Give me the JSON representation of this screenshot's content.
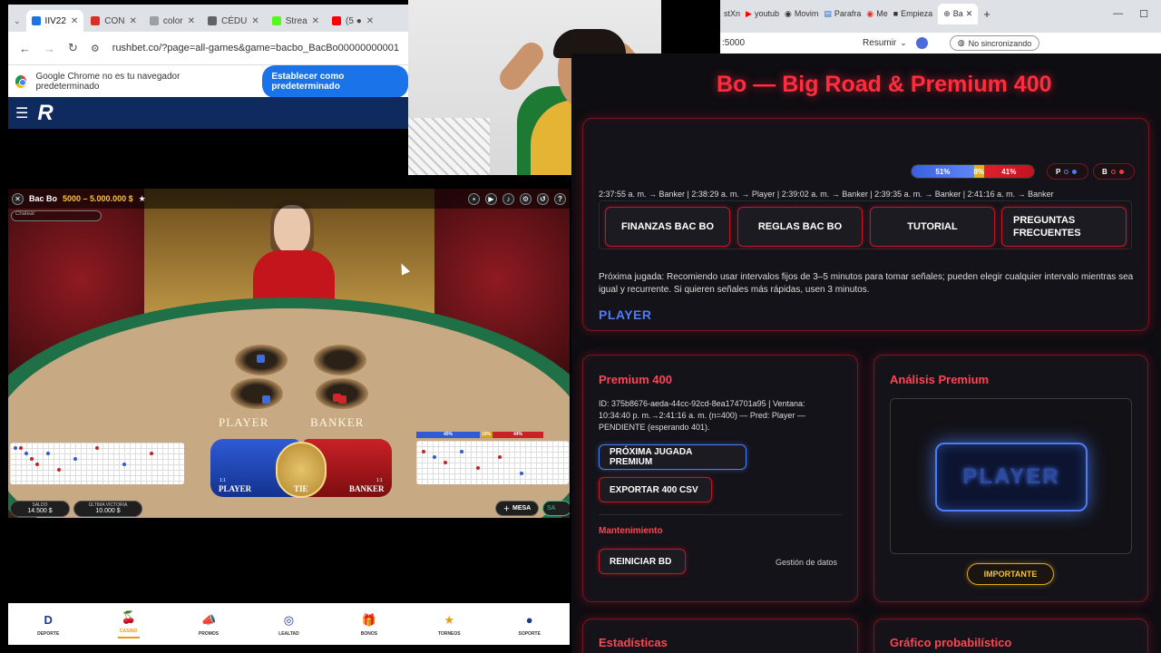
{
  "left_browser": {
    "tabs": [
      {
        "label": "IIV22",
        "color": "#1a73e8"
      },
      {
        "label": "CON",
        "color": "#d93025"
      },
      {
        "label": "color",
        "color": "#9aa0a6"
      },
      {
        "label": "CÉDU",
        "color": "#5f6368"
      },
      {
        "label": "Strea",
        "color": "#53fc18"
      },
      {
        "label": "(5 ●",
        "color": "#ff0000"
      }
    ],
    "url": "rushbet.co/?page=all-games&game=bacbo_BacBo00000000001",
    "info_text": "Google Chrome no es tu navegador predeterminado",
    "default_button": "Establecer como predeterminado",
    "logo": "R"
  },
  "game": {
    "name": "Bac Bo",
    "range": "5000 – 5.000.000 $",
    "chat_placeholder": "Chatear",
    "labels": {
      "player": "PLAYER",
      "banker": "BANKER",
      "tie": "TIE"
    },
    "payout_player": "1:1",
    "payout_banker": "1:1",
    "mini_ratio": {
      "player": "40%",
      "tie": "10%",
      "banker": "44%"
    },
    "balance_label": "SALDO",
    "balance_value": "14.500 $",
    "last_win_label": "ÚLTIMA VICTORIA",
    "last_win_value": "10.000 $",
    "mesa_button": "MESA",
    "next_button": "SA"
  },
  "bottom_nav": [
    {
      "label": "DEPORTE",
      "icon": "D"
    },
    {
      "label": "CASINO",
      "icon": "🍒"
    },
    {
      "label": "PROMOS",
      "icon": "📣"
    },
    {
      "label": "LEALTAD",
      "icon": "◎"
    },
    {
      "label": "BONOS",
      "icon": "🎁"
    },
    {
      "label": "TORNEOS",
      "icon": "★"
    },
    {
      "label": "SOPORTE",
      "icon": "●"
    }
  ],
  "right_browser": {
    "tabs": [
      "youtub",
      "Movim",
      "Parafra",
      "Me",
      "Empieza",
      "Ba"
    ],
    "url_fragment": ":5000",
    "resume": "Resumir",
    "sync": "No sincronizando"
  },
  "dashboard": {
    "title": "Bo — Big Road & Premium 400",
    "ratio": {
      "player": "51%",
      "tie": "8%",
      "banker": "41%"
    },
    "pill_p": "P",
    "pill_b": "B",
    "history": "2:37:55 a. m. → Banker | 2:38:29 a. m. → Player | 2:39:02 a. m. → Banker | 2:39:35 a. m. → Banker | 2:41:16 a. m. → Banker",
    "buttons": [
      "FINANZAS BAC BO",
      "REGLAS BAC BO",
      "TUTORIAL",
      "PREGUNTAS FRECUENTES"
    ],
    "next_play": "Próxima jugada: Recomiendo usar intervalos fijos de 3–5 minutos para tomar señales; pueden elegir cualquier intervalo mientras sea igual y recurrente. Si quieren señales más rápidas, usen 3 minutos.",
    "signal": "PLAYER",
    "premium": {
      "title": "Premium 400",
      "meta": "ID: 375b8676-aeda-44cc-92cd-8ea174701a95 | Ventana: 10:34:40 p. m.→2:41:16 a. m. (n=400) — Pred: Player — PENDIENTE (esperando 401).",
      "next_button": "PRÓXIMA JUGADA PREMIUM",
      "export_button": "EXPORTAR 400 CSV",
      "maintenance_title": "Mantenimiento",
      "reset_button": "REINICIAR BD",
      "data_management": "Gestión de datos"
    },
    "analysis": {
      "title": "Análisis Premium",
      "result": "PLAYER",
      "important_button": "IMPORTANTE"
    },
    "stats_title": "Estadísticas",
    "graph_title": "Gráfico probabilístico"
  }
}
